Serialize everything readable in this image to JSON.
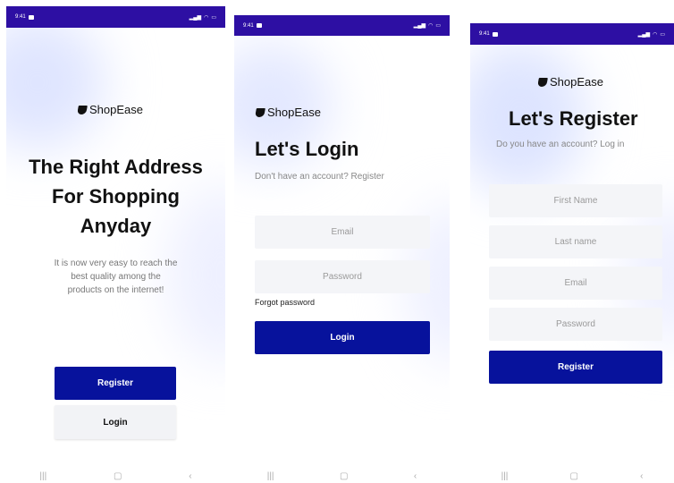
{
  "status_bar": {
    "time": "9:41"
  },
  "brand": {
    "name": "ShopEase"
  },
  "welcome": {
    "headline_line1": "The Right Address",
    "headline_line2": "For Shopping",
    "headline_line3": "Anyday",
    "subtext_line1": "It is now very easy to reach the",
    "subtext_line2": "best quality among the",
    "subtext_line3": "products on the internet!",
    "register_label": "Register",
    "login_label": "Login"
  },
  "login": {
    "title": "Let's Login",
    "subtitle": "Don't have an account? Register",
    "email_placeholder": "Email",
    "password_placeholder": "Password",
    "forgot_label": "Forgot password",
    "login_button_label": "Login"
  },
  "register": {
    "title": "Let's Register",
    "subtitle": "Do you have an account? Log in",
    "first_name_placeholder": "First Name",
    "last_name_placeholder": "Last name",
    "email_placeholder": "Email",
    "password_placeholder": "Password",
    "register_button_label": "Register"
  },
  "colors": {
    "status_bar": "#2d0fa3",
    "primary_button": "#07129c",
    "input_background": "#f4f5f8"
  }
}
